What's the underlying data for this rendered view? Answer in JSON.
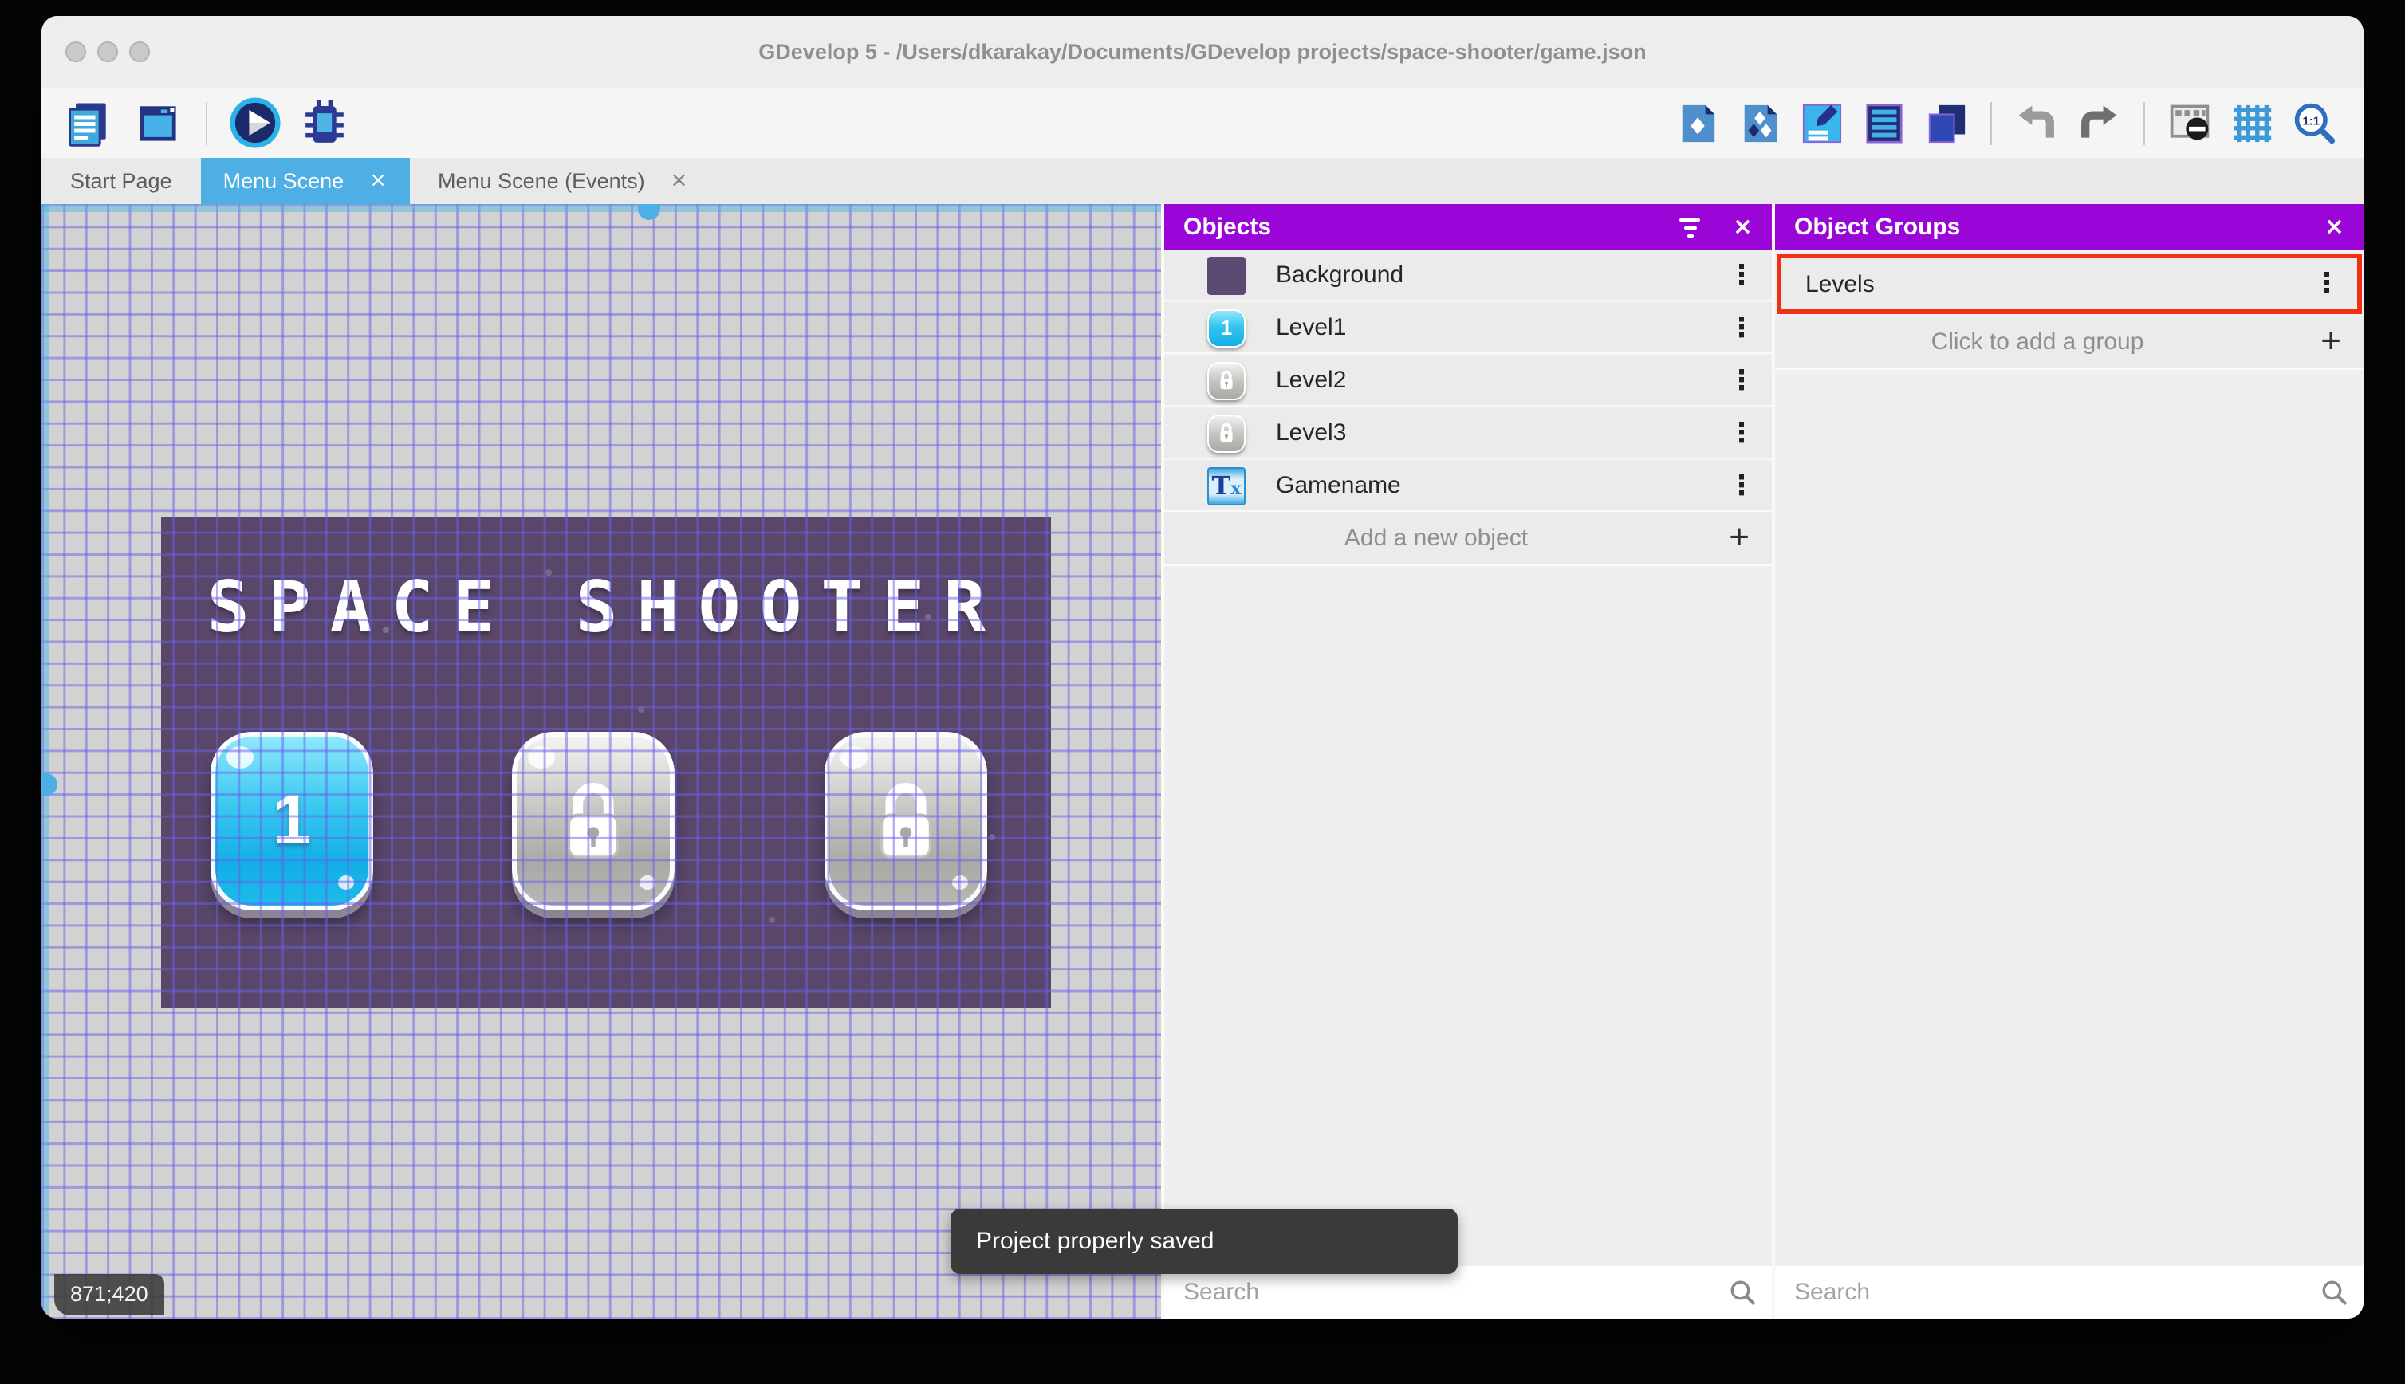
{
  "window_title": "GDevelop 5 - /Users/dkarakay/Documents/GDevelop projects/space-shooter/game.json",
  "toolbar": {
    "zoom_ratio": "1:1",
    "left_icons": [
      "project-manager-icon",
      "scene-properties-icon",
      "preview-play-icon",
      "debug-icon"
    ],
    "right_icons": [
      "objects-panel-icon",
      "object-groups-panel-icon",
      "properties-panel-icon",
      "instances-list-icon",
      "layers-panel-icon",
      "undo-icon",
      "redo-icon",
      "mask-icon",
      "grid-icon",
      "zoom-1-1-icon"
    ]
  },
  "tabs": [
    {
      "label": "Start Page",
      "active": false,
      "closable": false
    },
    {
      "label": "Menu Scene",
      "active": true,
      "closable": true
    },
    {
      "label": "Menu Scene (Events)",
      "active": false,
      "closable": true
    }
  ],
  "canvas": {
    "cursor_coordinates": "871;420",
    "toast_message": "Project properly saved",
    "game_preview": {
      "title": "SPACE SHOOTER",
      "level_buttons": [
        {
          "label": "1",
          "state": "unlocked"
        },
        {
          "label": "",
          "state": "locked"
        },
        {
          "label": "",
          "state": "locked"
        }
      ]
    }
  },
  "objects_panel": {
    "title": "Objects",
    "items": [
      {
        "name": "Background",
        "icon": "color-swatch"
      },
      {
        "name": "Level1",
        "icon": "blue-level-button"
      },
      {
        "name": "Level2",
        "icon": "locked-level-button"
      },
      {
        "name": "Level3",
        "icon": "locked-level-button"
      },
      {
        "name": "Gamename",
        "icon": "text-object"
      }
    ],
    "add_button_label": "Add a new object",
    "search_placeholder": "Search"
  },
  "object_groups_panel": {
    "title": "Object Groups",
    "items": [
      {
        "name": "Levels",
        "highlighted": true
      }
    ],
    "add_button_label": "Click to add a group",
    "search_placeholder": "Search"
  },
  "glyphs": {
    "close": "×",
    "plus": "+",
    "kebab": "⋮",
    "level1_icon_digit": "1",
    "text_icon_T": "T",
    "text_icon_x": "x"
  },
  "colors": {
    "accent_blue": "#4DAFE4",
    "panel_header_purple": "#9A06D8",
    "selection_red": "#F23016",
    "game_background": "#594669",
    "toast_background": "#3a3a3a"
  }
}
